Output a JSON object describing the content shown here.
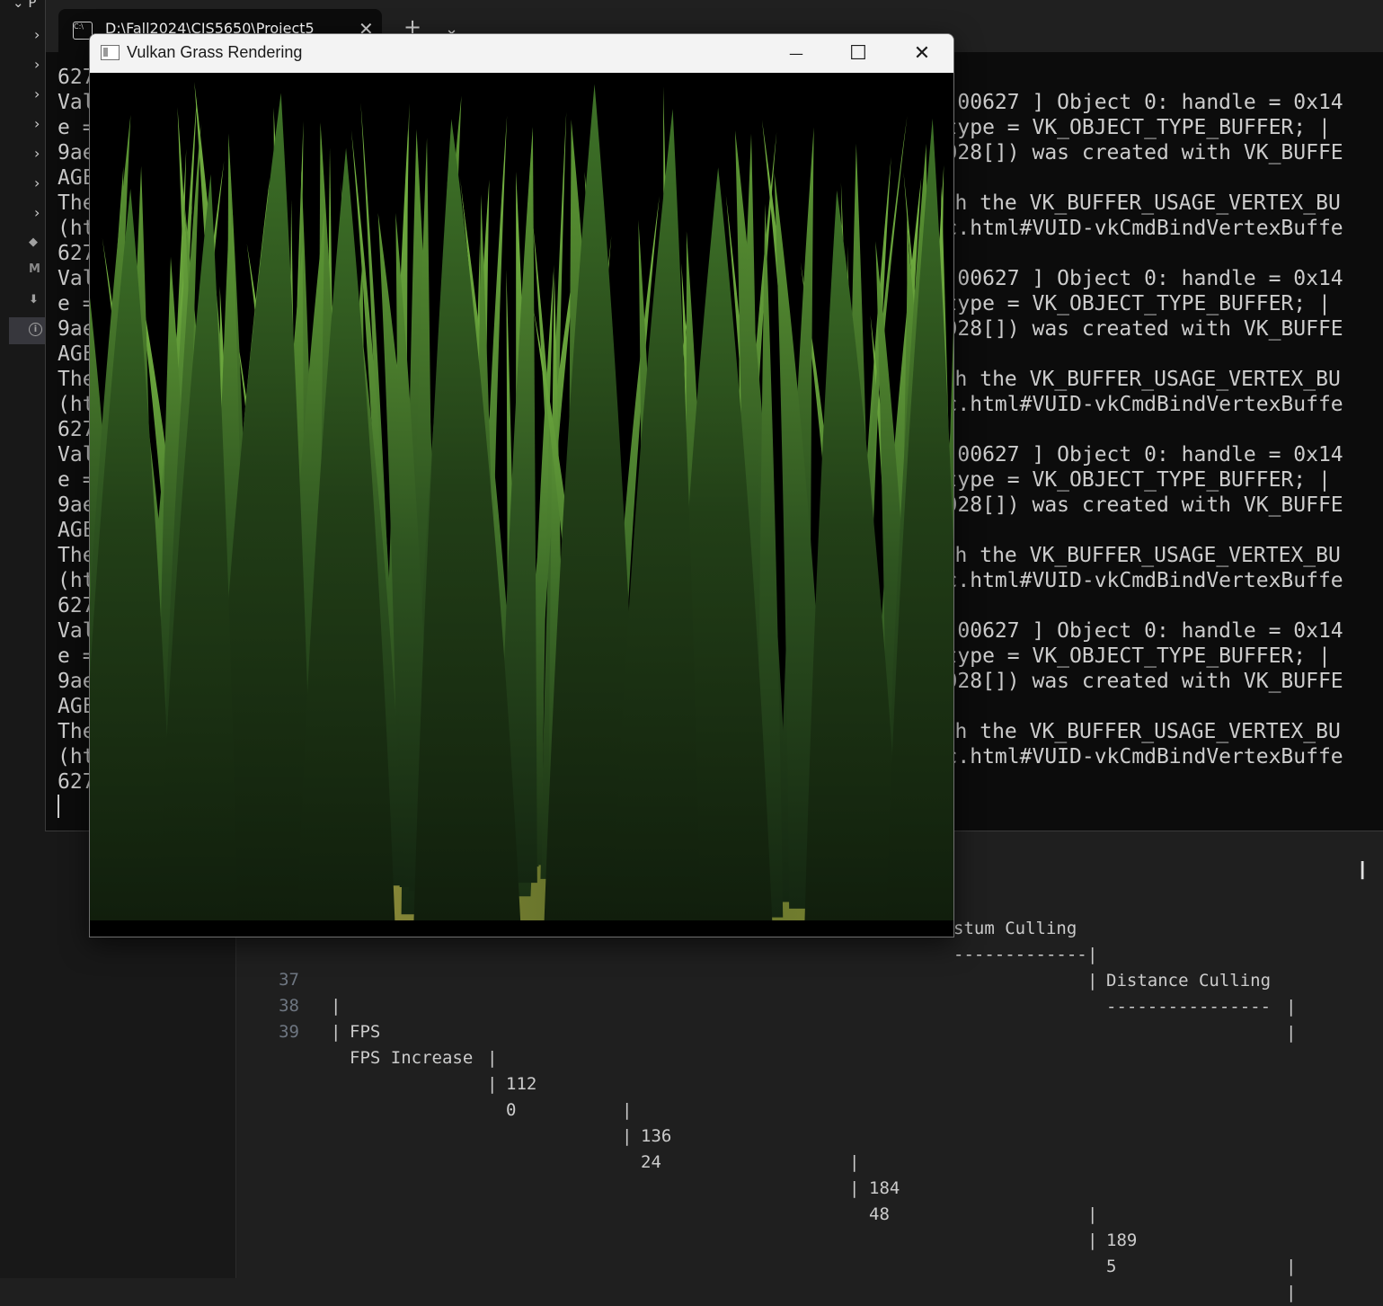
{
  "explorer": {
    "top_folder_label": "P",
    "chevron_glyph": "›",
    "mini_icons": [
      "M",
      "i"
    ]
  },
  "terminal": {
    "tab_title": "D:\\Fall2024\\CIS5650\\Project5",
    "tab_icon_text": "C:\\",
    "close_glyph": "✕",
    "new_tab_glyph": "+",
    "dropdown_glyph": "⌄",
    "left_lines": [
      "627",
      "Val",
      "e =",
      "9ae",
      "AGE",
      "The",
      "(ht",
      "627",
      "Val",
      "e =",
      "9ae",
      "AGE",
      "The",
      "(ht",
      "627",
      "Val",
      "e =",
      "9ae",
      "AGE",
      "The",
      "(ht",
      "627",
      "Val",
      "e =",
      "9ae",
      "AGE",
      "The",
      "(ht",
      "627"
    ],
    "right_blocks": [
      [
        "ers-00627 ] Object 0: handle = 0x14",
        "8, type = VK_OBJECT_TYPE_BUFFER; |",
        "000028[]) was created with VK_BUFFE",
        "",
        "with the VK_BUFFER_USAGE_VERTEX_BU",
        "spec.html#VUID-vkCmdBindVertexBuffe"
      ],
      [
        "ers-00627 ] Object 0: handle = 0x14",
        "8, type = VK_OBJECT_TYPE_BUFFER; |",
        "000028[]) was created with VK_BUFFE",
        "",
        "with the VK_BUFFER_USAGE_VERTEX_BU",
        "spec.html#VUID-vkCmdBindVertexBuffe"
      ],
      [
        "ers-00627 ] Object 0: handle = 0x14",
        "8, type = VK_OBJECT_TYPE_BUFFER; |",
        "000028[]) was created with VK_BUFFE",
        "",
        "with the VK_BUFFER_USAGE_VERTEX_BU",
        "spec.html#VUID-vkCmdBindVertexBuffe"
      ],
      [
        "ers-00627 ] Object 0: handle = 0x14",
        "8, type = VK_OBJECT_TYPE_BUFFER; |",
        "000028[]) was created with VK_BUFFE",
        "",
        "with the VK_BUFFER_USAGE_VERTEX_BU",
        "spec.html#VUID-vkCmdBindVertexBuffe"
      ]
    ]
  },
  "vulkan_window": {
    "title": "Vulkan Grass Rendering",
    "minimize_glyph": "—",
    "maximize_glyph": "☐",
    "close_glyph": "✕"
  },
  "markdown_table": {
    "header_partial": [
      "stum Culling",
      "Distance Culling"
    ],
    "separator_partial": [
      "-------------",
      "----------------"
    ],
    "rows": [
      {
        "line": "37",
        "label": "FPS",
        "values": [
          "112",
          "136",
          "184",
          "189"
        ]
      },
      {
        "line": "38",
        "label": "FPS Increase",
        "values": [
          "0",
          "24",
          "48",
          "5"
        ]
      }
    ],
    "empty_line": "39",
    "pipe": "|"
  },
  "cursor_glyph": "I"
}
